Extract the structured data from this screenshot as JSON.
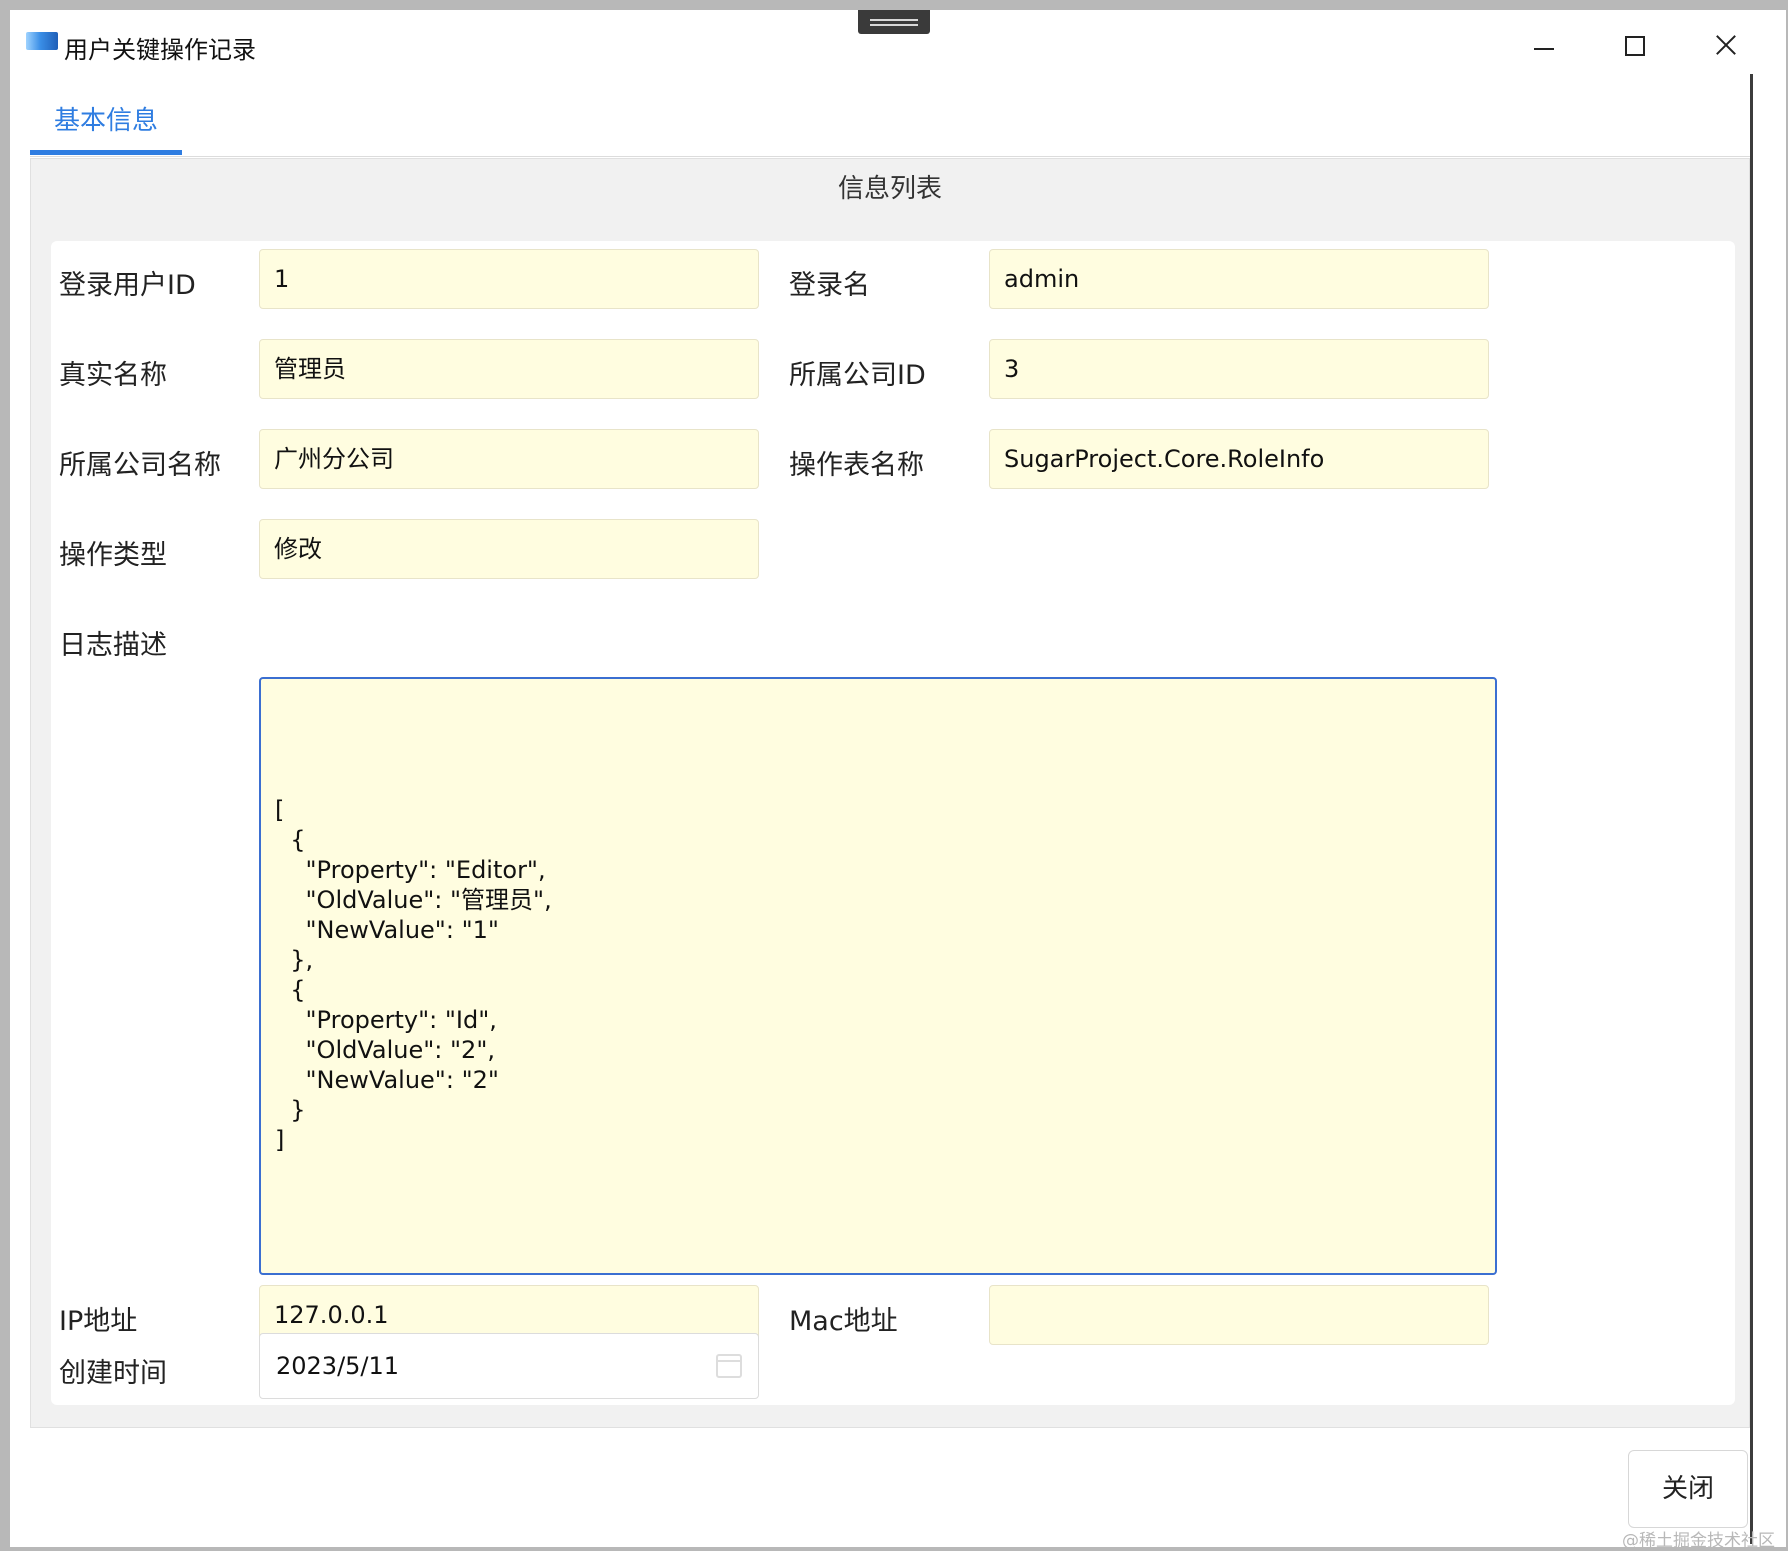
{
  "window": {
    "title": "用户关键操作记录"
  },
  "tabs": [
    {
      "label": "基本信息",
      "active": true
    }
  ],
  "panel": {
    "title": "信息列表"
  },
  "form": {
    "login_user_id": {
      "label": "登录用户ID",
      "value": "1"
    },
    "login_name": {
      "label": "登录名",
      "value": "admin"
    },
    "real_name": {
      "label": "真实名称",
      "value": "管理员"
    },
    "company_id": {
      "label": "所属公司ID",
      "value": "3"
    },
    "company_name": {
      "label": "所属公司名称",
      "value": "广州分公司"
    },
    "table_name": {
      "label": "操作表名称",
      "value": "SugarProject.Core.RoleInfo"
    },
    "operation_type": {
      "label": "操作类型",
      "value": "修改"
    },
    "log_description": {
      "label": "日志描述",
      "value": "[\n  {\n    \"Property\": \"Editor\",\n    \"OldValue\": \"管理员\",\n    \"NewValue\": \"1\"\n  },\n  {\n    \"Property\": \"Id\",\n    \"OldValue\": \"2\",\n    \"NewValue\": \"2\"\n  }\n]"
    },
    "ip_address": {
      "label": "IP地址",
      "value": "127.0.0.1"
    },
    "mac_address": {
      "label": "Mac地址",
      "value": ""
    },
    "created_time": {
      "label": "创建时间",
      "value": "2023/5/11"
    }
  },
  "footer": {
    "close_label": "关闭"
  },
  "watermark": "@稀土掘金技术社区",
  "icons": {
    "app": "app-window-icon",
    "minimize": "minimize-icon",
    "maximize": "maximize-icon",
    "close": "close-icon",
    "calendar": "calendar-icon"
  },
  "colors": {
    "accent": "#2f7de1",
    "field_bg": "#fffde0",
    "focus_border": "#3b6fd1"
  }
}
